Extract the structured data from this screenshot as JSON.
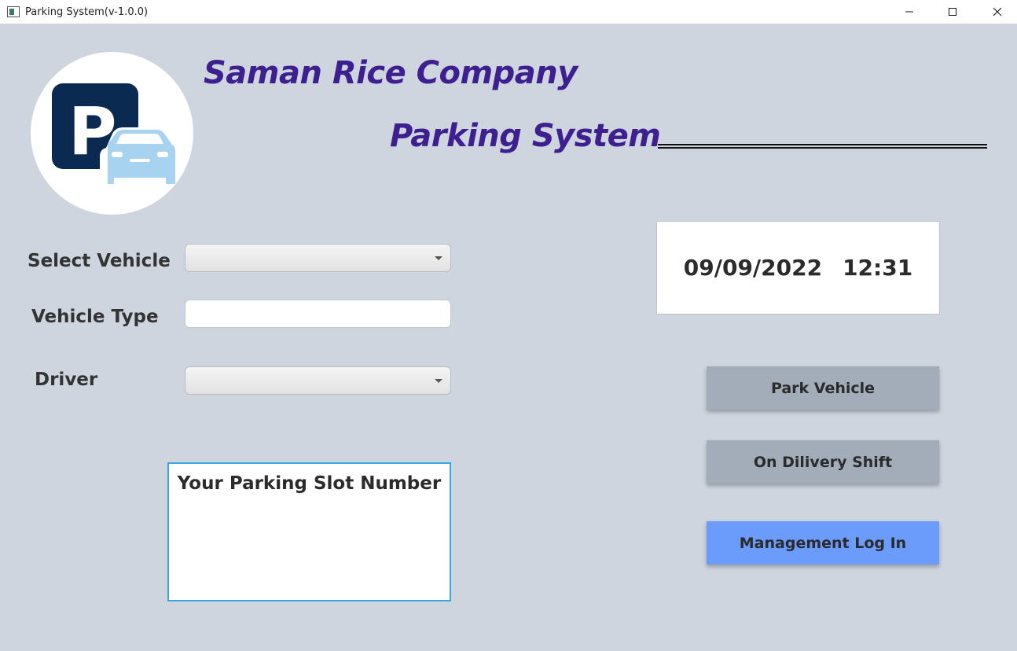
{
  "window": {
    "title": "Parking System(v-1.0.0)"
  },
  "header": {
    "company": "Saman Rice Company",
    "system": "Parking System",
    "logo_letter": "P"
  },
  "form": {
    "select_vehicle_label": "Select Vehicle",
    "select_vehicle_value": "",
    "vehicle_type_label": "Vehicle Type",
    "vehicle_type_value": "",
    "driver_label": "Driver",
    "driver_value": ""
  },
  "slot": {
    "title": "Your Parking Slot Number",
    "value": ""
  },
  "datetime": {
    "date": "09/09/2022",
    "time": "12:31"
  },
  "actions": {
    "park": "Park Vehicle",
    "delivery": "On Dilivery Shift",
    "login": "Management Log In"
  },
  "colors": {
    "background": "#ced5df",
    "title_purple": "#3d1f8f",
    "logo_navy": "#0b2a52",
    "logo_car": "#a7d3f0",
    "button_gray": "#a2adb9",
    "button_blue": "#6b9cfb",
    "slot_border": "#3aa6dd"
  },
  "icons": {
    "app": "app-window-icon",
    "minimize": "minimize-icon",
    "maximize": "maximize-icon",
    "close": "close-icon",
    "logo": "parking-car-logo-icon",
    "combo_arrow": "chevron-down-icon"
  }
}
